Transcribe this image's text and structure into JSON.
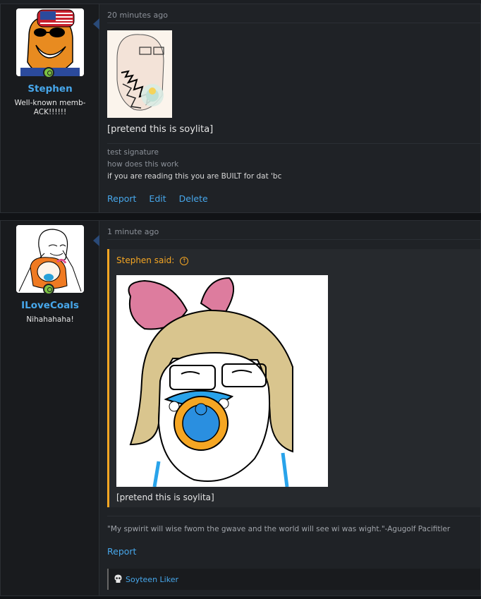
{
  "posts": [
    {
      "author": "Stephen",
      "user_title": "Well-known memb- ACK!!!!!!",
      "time": "20 minutes ago",
      "body": "[pretend this is soylita]",
      "signature": [
        "test signature",
        "how does this work",
        "if you are reading this you are BUILT for dat 'bc"
      ],
      "actions": [
        "Report",
        "Edit",
        "Delete"
      ]
    },
    {
      "author": "ILoveCoals",
      "user_title": "Nihahahaha!",
      "time": "1 minute ago",
      "quote": {
        "author_label": "Stephen said:",
        "text": "[pretend this is soylita]"
      },
      "signature": "\"My spwirit will wise fwom the gwave and the world will see wi was wight.\"-Agugolf Pacifitler",
      "actions": [
        "Report"
      ],
      "badge": "Soyteen Liker"
    }
  ],
  "colors": {
    "accent": "#47a7eb",
    "quote_border": "#f5a623",
    "online": "#7cc243"
  },
  "icons": [
    "online-status-icon",
    "quote-jump-icon",
    "skull-icon"
  ]
}
